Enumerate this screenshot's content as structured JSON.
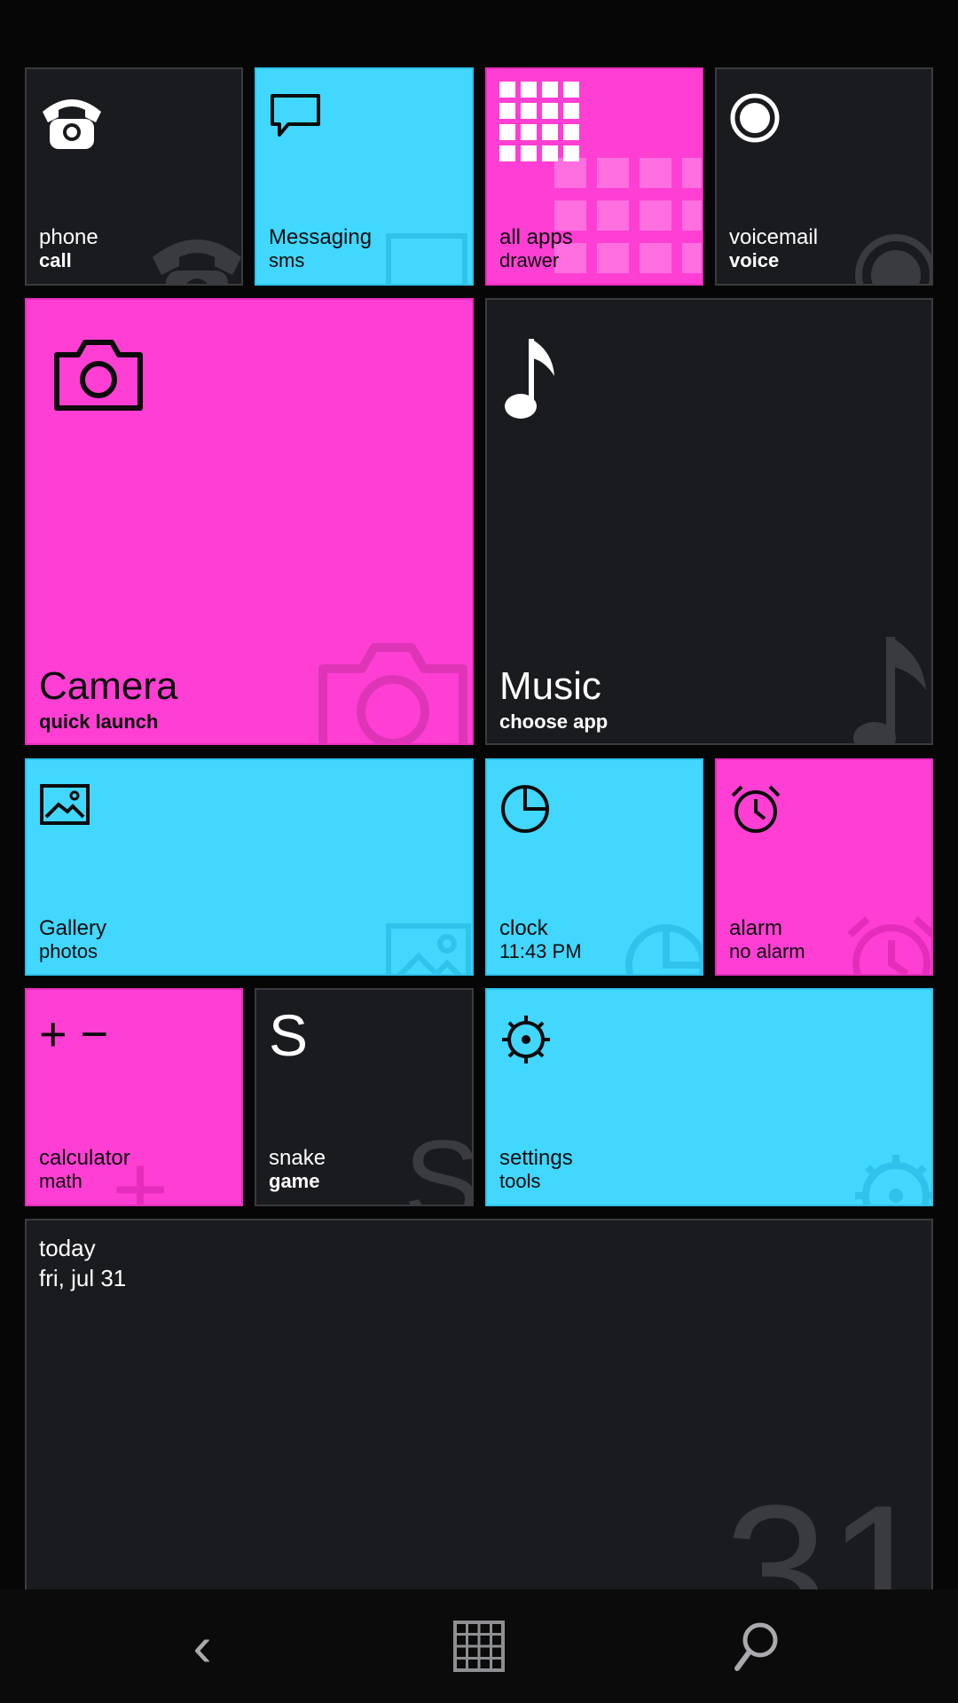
{
  "colors": {
    "background": "#060606",
    "dark_tile": "#1a1b1f",
    "cyan": "#41d7ff",
    "pink": "#ff3fd3"
  },
  "tiles": {
    "phone": {
      "title": "phone",
      "subtitle": "call",
      "icon": "phone-icon"
    },
    "messaging": {
      "title": "Messaging",
      "subtitle": "sms",
      "icon": "message-icon"
    },
    "allapps": {
      "title": "all apps",
      "subtitle": "drawer",
      "icon": "grid-icon"
    },
    "voicemail": {
      "title": "voicemail",
      "subtitle": "voice",
      "icon": "voicemail-icon"
    },
    "camera": {
      "title": "Camera",
      "subtitle": "quick launch",
      "icon": "camera-icon"
    },
    "music": {
      "title": "Music",
      "subtitle": "choose app",
      "icon": "music-note-icon"
    },
    "gallery": {
      "title": "Gallery",
      "subtitle": "photos",
      "icon": "picture-icon"
    },
    "clock": {
      "title": "clock",
      "subtitle": "11:43 PM",
      "icon": "clock-icon"
    },
    "alarm": {
      "title": "alarm",
      "subtitle": "no alarm",
      "icon": "alarm-clock-icon"
    },
    "calculator": {
      "title": "calculator",
      "subtitle": "math",
      "icon_text": "+ −"
    },
    "snake": {
      "title": "snake",
      "subtitle": "game",
      "icon_text": "S",
      "bg_text": "S"
    },
    "settings": {
      "title": "settings",
      "subtitle": "tools",
      "icon": "gear-icon"
    },
    "today": {
      "title": "today",
      "subtitle": "fri, jul 31",
      "bg_text": "31"
    }
  },
  "nav": {
    "back_glyph": "‹",
    "back": "back-icon",
    "home": "grid-icon",
    "search": "search-icon"
  }
}
